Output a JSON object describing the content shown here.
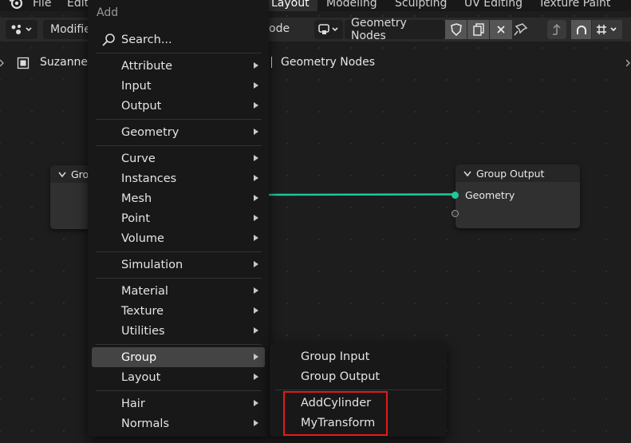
{
  "topbar": {
    "menu": [
      "File",
      "Edit"
    ],
    "workspaces": [
      "Layout",
      "Modeling",
      "Sculpting",
      "UV Editing",
      "Texture Paint"
    ],
    "active_workspace": "Layout"
  },
  "header": {
    "modifier_label": "Modifie",
    "editor_type_label": "ode",
    "node_tree_name": "Geometry Nodes"
  },
  "breadcrumb": {
    "object": "Suzanne",
    "tree": "Geometry Nodes"
  },
  "nodes": {
    "group_input": {
      "title": "Gro"
    },
    "group_output": {
      "title": "Group Output",
      "socket_label": "Geometry"
    }
  },
  "add_menu": {
    "title": "Add",
    "search": "Search...",
    "items": [
      {
        "label": "Attribute"
      },
      {
        "label": "Input"
      },
      {
        "label": "Output"
      },
      {
        "label": "Geometry"
      },
      {
        "label": "Curve"
      },
      {
        "label": "Instances"
      },
      {
        "label": "Mesh"
      },
      {
        "label": "Point"
      },
      {
        "label": "Volume"
      },
      {
        "label": "Simulation"
      },
      {
        "label": "Material"
      },
      {
        "label": "Texture"
      },
      {
        "label": "Utilities"
      },
      {
        "label": "Group"
      },
      {
        "label": "Layout"
      },
      {
        "label": "Hair"
      },
      {
        "label": "Normals"
      }
    ],
    "highlighted": "Group"
  },
  "group_submenu": {
    "items": [
      "Group Input",
      "Group Output",
      "AddCylinder",
      "MyTransform"
    ]
  },
  "colors": {
    "link": "#1fc99a",
    "highlight_box": "#e01b1b",
    "menu_bg": "#181818",
    "hover": "#444444"
  }
}
